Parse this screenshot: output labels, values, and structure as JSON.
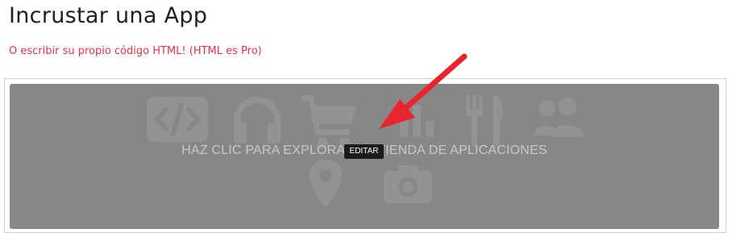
{
  "header": {
    "title": "Incrustar una App",
    "subtitle": "O escribir su propio código HTML! (HTML es Pro)"
  },
  "embed": {
    "placeholder_text": "HAZ CLIC PARA EXPLORAR LA TIENDA DE APLICACIONES",
    "edit_label": "EDITAR",
    "background_icons": [
      "code-icon",
      "headphones-icon",
      "shopping-cart-icon",
      "bar-chart-icon",
      "fork-knife-icon",
      "users-icon",
      "map-pin-icon",
      "camera-icon"
    ]
  },
  "colors": {
    "accent": "#e0344a",
    "placeholder_bg": "#878787",
    "arrow": "#e8252e"
  }
}
